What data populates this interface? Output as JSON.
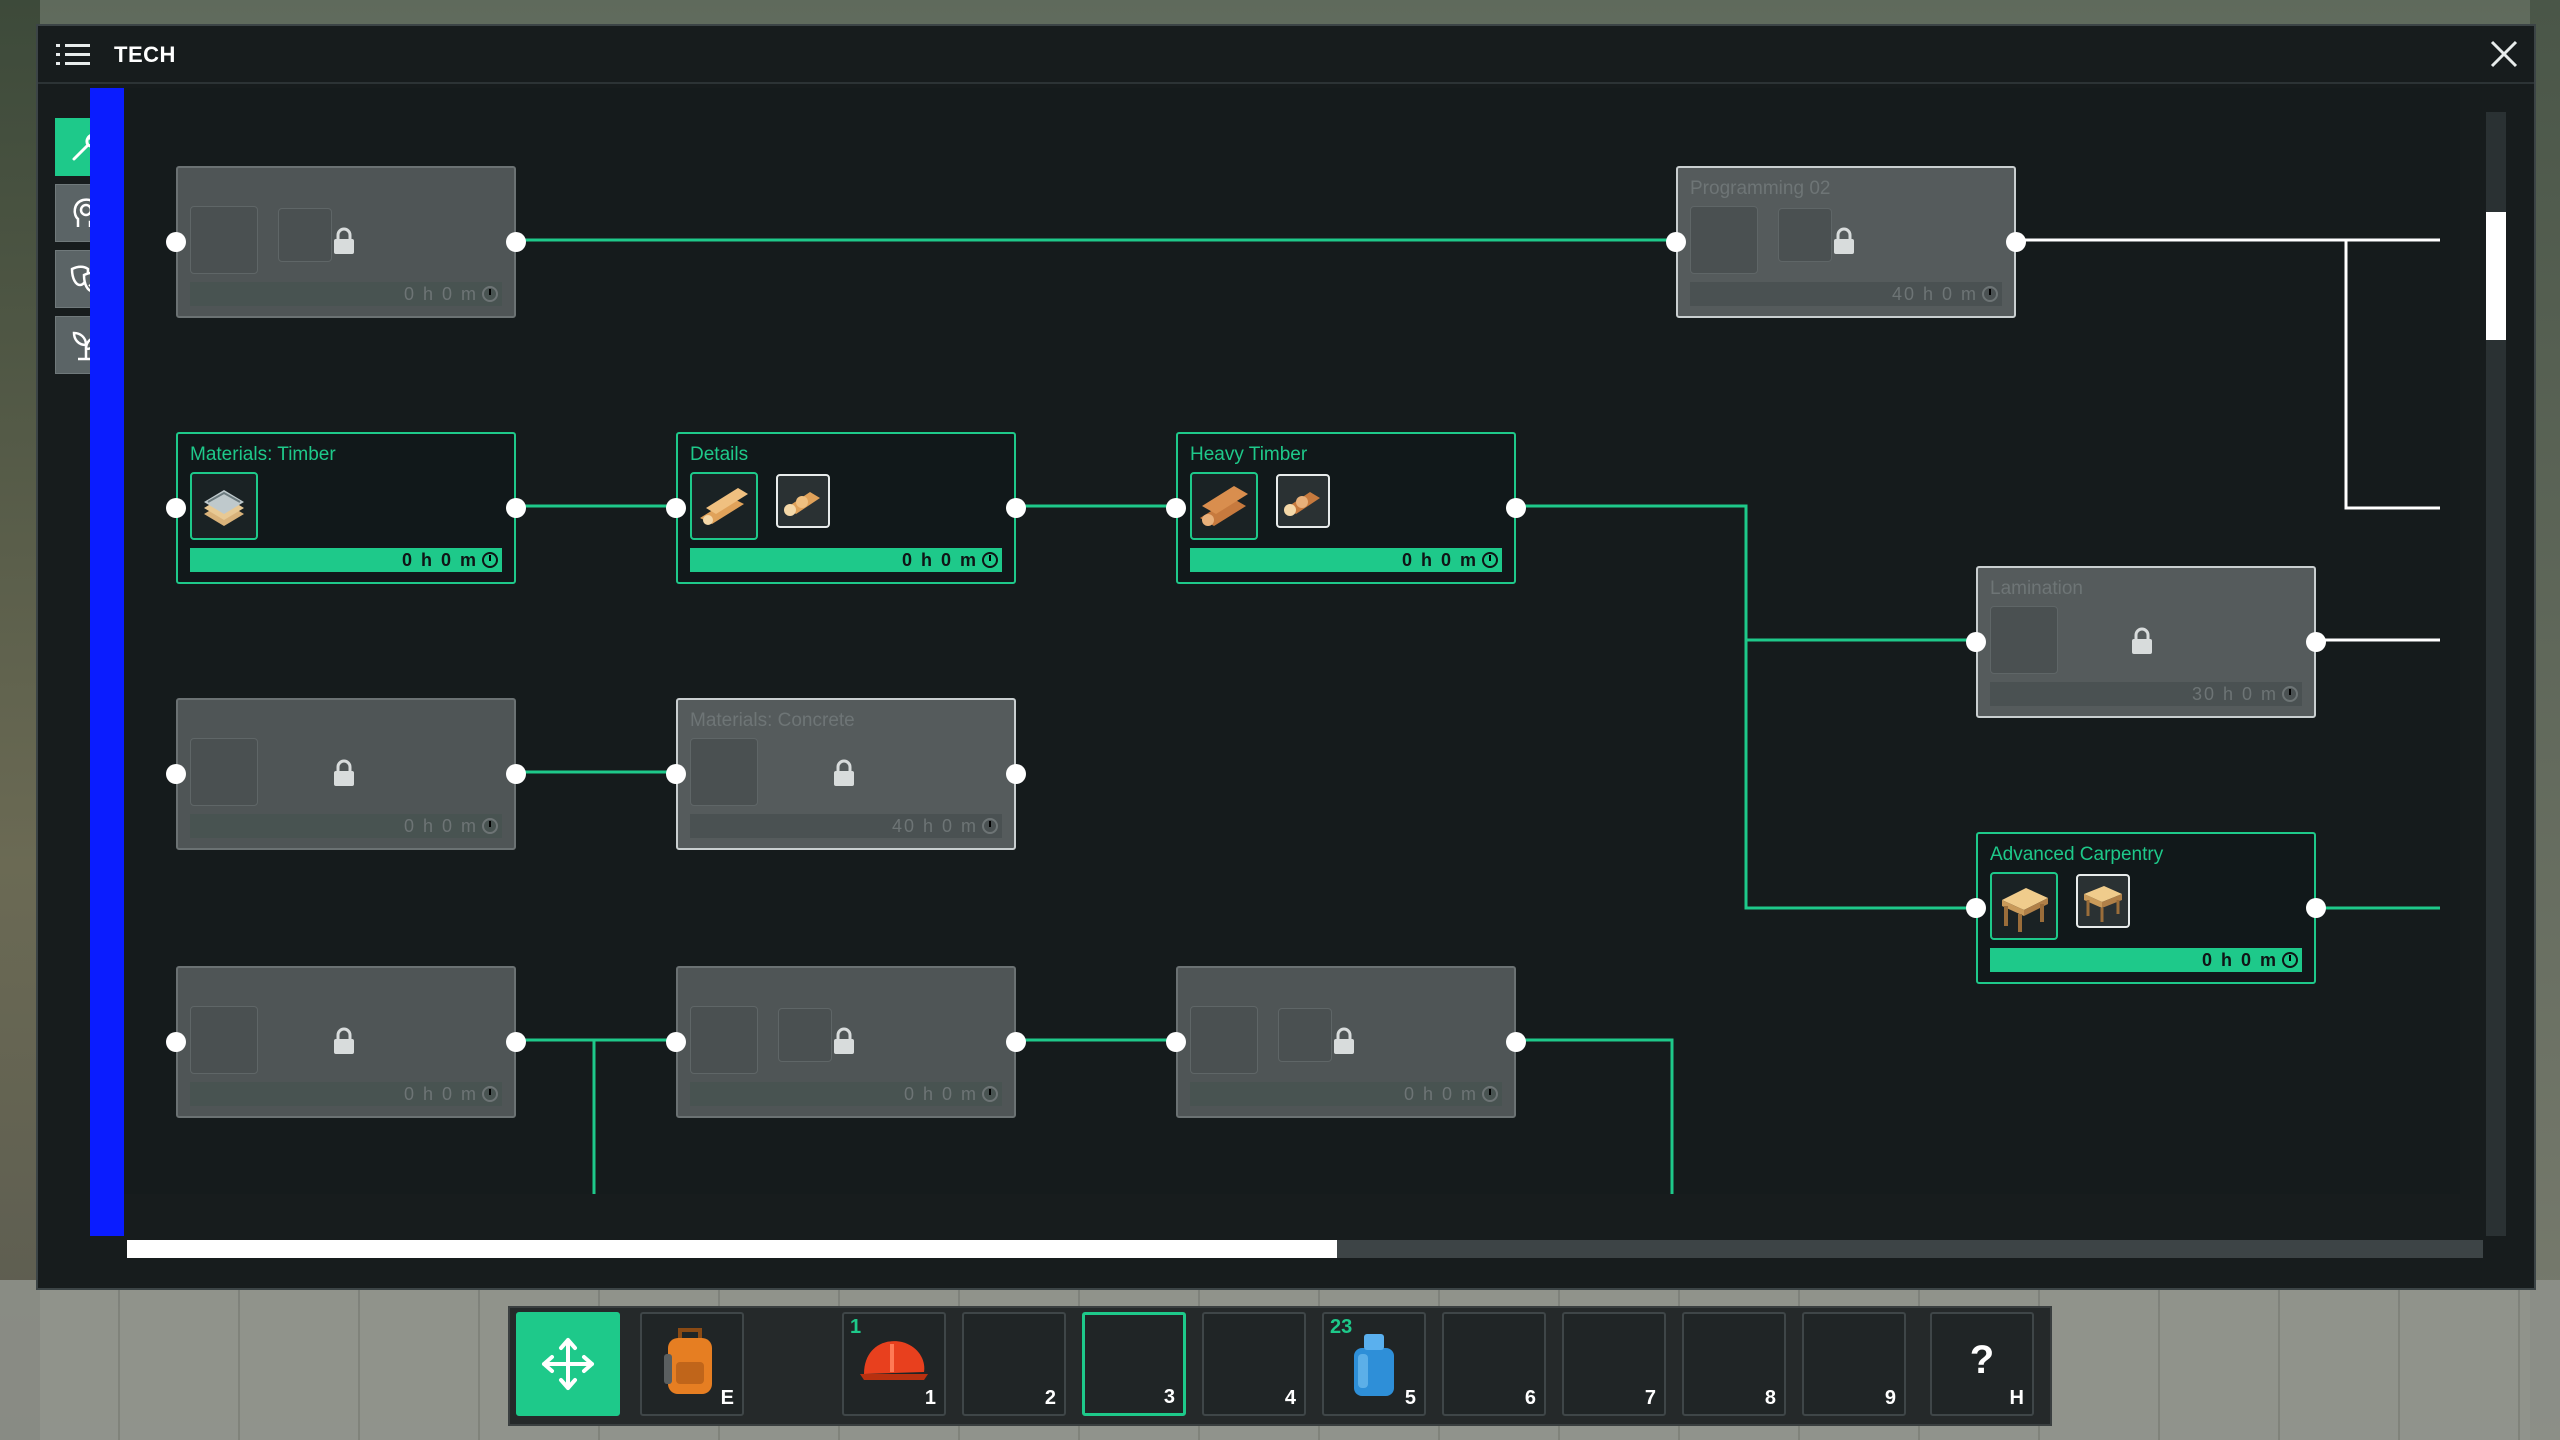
{
  "window": {
    "title": "TECH"
  },
  "colors": {
    "accent": "#1ec98a",
    "locked_bg": "#4f5556",
    "window_bg": "#171c1d",
    "blue_bar": "#0a1cff"
  },
  "sidebar": {
    "tabs": [
      {
        "icon": "wrench-icon",
        "active": true
      },
      {
        "icon": "head-gear-icon",
        "active": false
      },
      {
        "icon": "theater-masks-icon",
        "active": false
      },
      {
        "icon": "sprout-icon",
        "active": false
      }
    ]
  },
  "nodes": {
    "r0c0": {
      "name": "",
      "time": "0 h 0 m",
      "state": "locked"
    },
    "programming": {
      "name": "Programming 02",
      "time": "40 h 0 m",
      "state": "locked"
    },
    "timber": {
      "name": "Materials: Timber",
      "time": "0 h 0 m",
      "state": "unlocked"
    },
    "details": {
      "name": "Details",
      "time": "0 h 0 m",
      "state": "unlocked"
    },
    "heavy_timber": {
      "name": "Heavy Timber",
      "time": "0 h 0 m",
      "state": "unlocked"
    },
    "lamination": {
      "name": "Lamination",
      "time": "30 h 0 m",
      "state": "locked"
    },
    "r2c0": {
      "name": "",
      "time": "0 h 0 m",
      "state": "locked"
    },
    "concrete": {
      "name": "Materials: Concrete",
      "time": "40 h 0 m",
      "state": "locked"
    },
    "advanced_carpentry": {
      "name": "Advanced Carpentry",
      "time": "0 h 0 m",
      "state": "unlocked"
    },
    "r3c0": {
      "name": "",
      "time": "0 h 0 m",
      "state": "locked"
    },
    "r3c1": {
      "name": "",
      "time": "0 h 0 m",
      "state": "locked"
    },
    "r3c2": {
      "name": "",
      "time": "0 h 0 m",
      "state": "locked"
    }
  },
  "scroll": {
    "horizontal_fraction_visible": 0.51,
    "vertical_position": 0.09
  },
  "hotbar": {
    "slots": [
      {
        "key": "",
        "item": "move-icon",
        "count": ""
      },
      {
        "key": "E",
        "item": "backpack-icon",
        "count": ""
      },
      {
        "key": "1",
        "item": "hard-hat-icon",
        "count": "1"
      },
      {
        "key": "2",
        "item": "",
        "count": ""
      },
      {
        "key": "3",
        "item": "",
        "count": "",
        "selected": true
      },
      {
        "key": "4",
        "item": "",
        "count": ""
      },
      {
        "key": "5",
        "item": "water-jug-icon",
        "count": "23"
      },
      {
        "key": "6",
        "item": "",
        "count": ""
      },
      {
        "key": "7",
        "item": "",
        "count": ""
      },
      {
        "key": "8",
        "item": "",
        "count": ""
      },
      {
        "key": "9",
        "item": "",
        "count": ""
      },
      {
        "key": "H",
        "item": "help-icon",
        "count": "",
        "label": "?"
      }
    ]
  }
}
